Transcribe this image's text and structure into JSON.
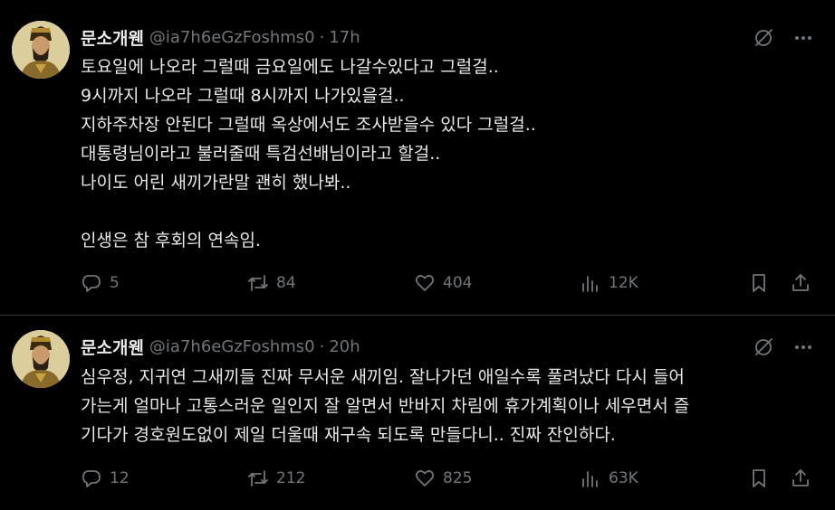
{
  "tweets": [
    {
      "display_name": "문소개웬",
      "handle": "@ia7h6eGzFoshms0",
      "separator": "·",
      "time": "17h",
      "lines": [
        "토요일에 나오라 그럴때 금요일에도 나갈수있다고 그럴걸..",
        "9시까지 나오라 그럴때 8시까지 나가있을걸..",
        "지하주차장 안된다 그럴때 옥상에서도 조사받을수 있다 그럴걸..",
        "대통령님이라고 불러줄때 특검선배님이라고 할걸..",
        "나이도 어린 새끼가란말 괜히 했나봐..",
        "",
        "인생은 참 후회의 연속임."
      ],
      "stats": {
        "replies": "5",
        "retweets": "84",
        "likes": "404",
        "views": "12K"
      }
    },
    {
      "display_name": "문소개웬",
      "handle": "@ia7h6eGzFoshms0",
      "separator": "·",
      "time": "20h",
      "lines": [
        "심우정, 지귀연 그새끼들 진짜 무서운 새끼임. 잘나가던 애일수록 풀려났다 다시 들어",
        "가는게 얼마나 고통스러운 일인지 잘 알면서 반바지 차림에 휴가계획이나 세우면서 즐",
        "기다가 경호원도없이 제일 더울때 재구속 되도록 만들다니.. 진짜 잔인하다."
      ],
      "stats": {
        "replies": "12",
        "retweets": "212",
        "likes": "825",
        "views": "63K"
      }
    }
  ],
  "icons": {
    "grok": "grok-icon",
    "more": "more-icon",
    "reply": "reply-icon",
    "retweet": "retweet-icon",
    "like": "heart-icon",
    "views": "views-icon",
    "bookmark": "bookmark-icon",
    "share": "share-icon"
  },
  "colors": {
    "background": "#000000",
    "text": "#e7e9ea",
    "muted": "#71767b",
    "divider": "#2f3336"
  }
}
